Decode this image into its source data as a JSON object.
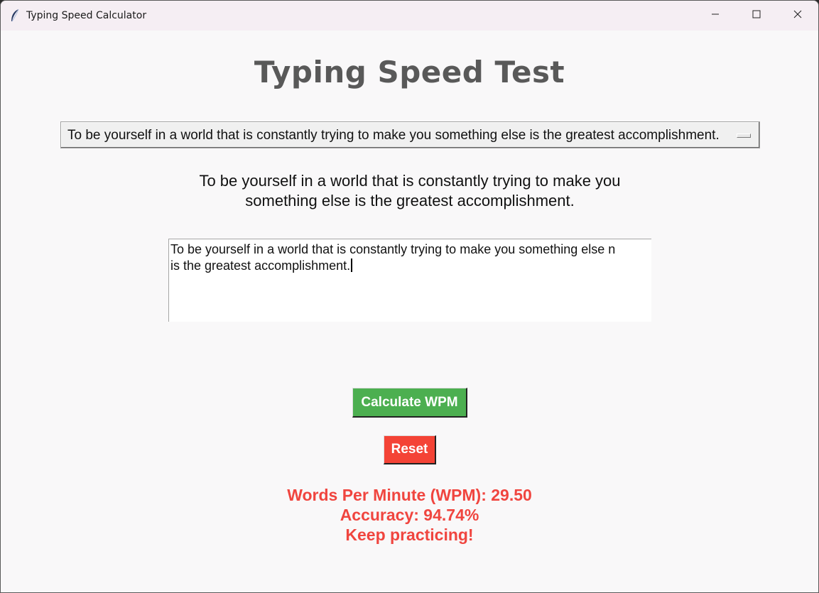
{
  "window": {
    "title": "Typing Speed Calculator",
    "icon": "feather-icon",
    "controls": [
      "minimize-icon",
      "maximize-icon",
      "close-icon"
    ]
  },
  "app": {
    "heading": "Typing Speed Test",
    "sentence_select": {
      "selected": "To be yourself in a world that is constantly trying to make you something else is the greatest accomplishment."
    },
    "sentence_display": {
      "line1": "To be yourself in a world that is constantly trying to make you",
      "line2": "something else is the greatest accomplishment."
    },
    "typing_input": {
      "line1": "To be yourself in a world that is constantly trying to make you something else  n",
      "line2": "is the greatest accomplishment."
    },
    "buttons": {
      "calculate": "Calculate WPM",
      "reset": "Reset"
    },
    "results": {
      "wpm": "Words Per Minute (WPM): 29.50",
      "accuracy": "Accuracy: 94.74%",
      "message": "Keep practicing!"
    }
  },
  "colors": {
    "calculate_button": "#4caf50",
    "reset_button": "#f44336",
    "result_text": "#f0453f",
    "heading_text": "#595959",
    "background": "#f9f8f9"
  }
}
